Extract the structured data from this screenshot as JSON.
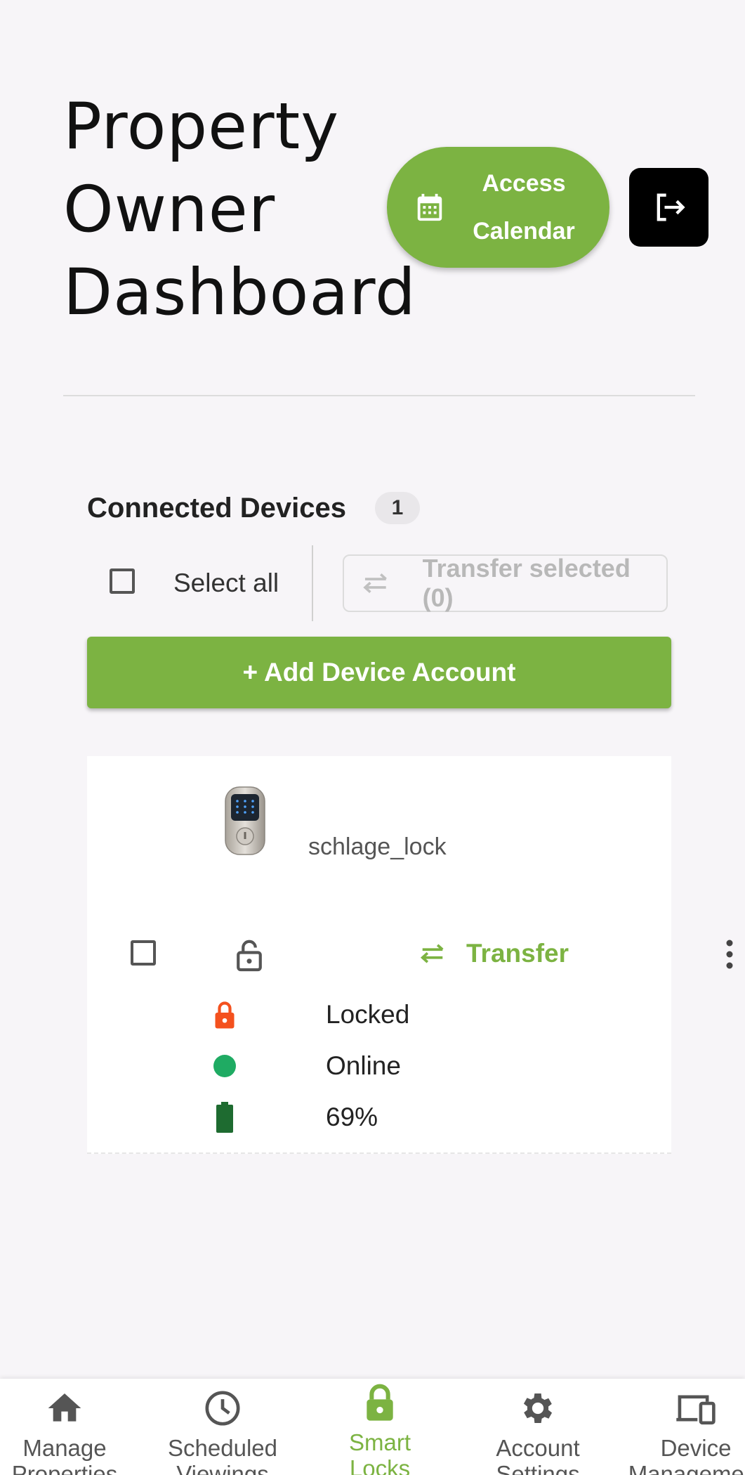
{
  "header": {
    "title": "Property Owner Dashboard",
    "calendar_button": "Access Calendar",
    "calendar_icon": "calendar-icon",
    "logout_icon": "logout-icon"
  },
  "devices_section": {
    "title": "Connected Devices",
    "count": "1",
    "select_all_label": "Select all",
    "transfer_selected_label": "Transfer selected (0)",
    "add_device_label": "+ Add Device Account"
  },
  "device": {
    "name": "schlage_lock",
    "transfer_label": "Transfer",
    "lock_status": "Locked",
    "connection_status": "Online",
    "battery": "69%",
    "status_colors": {
      "locked": "#f4511e",
      "online": "#1fab63",
      "battery": "#1e6b30"
    }
  },
  "bottom_nav": {
    "items": [
      {
        "label": "Manage\nProperties",
        "icon": "home-icon",
        "active": false
      },
      {
        "label": "Scheduled\nViewings",
        "icon": "clock-icon",
        "active": false
      },
      {
        "label": "Smart\nLocks",
        "icon": "lock-icon",
        "active": true
      },
      {
        "label": "Account\nSettings",
        "icon": "gear-icon",
        "active": false
      },
      {
        "label": "Device\nManagement",
        "icon": "devices-icon",
        "active": false
      }
    ]
  },
  "colors": {
    "accent": "#7cb342",
    "background": "#f7f5f8"
  }
}
